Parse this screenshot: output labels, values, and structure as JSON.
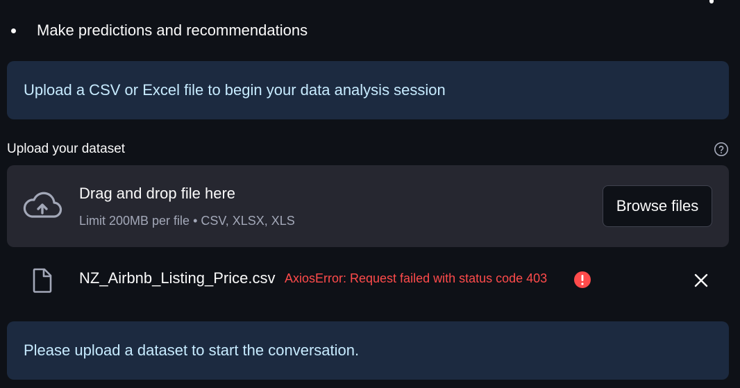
{
  "bullet": {
    "text": "Make predictions and recommendations"
  },
  "info_top": {
    "text": "Upload a CSV or Excel file to begin your data analysis session"
  },
  "uploader": {
    "label": "Upload your dataset",
    "help_icon": "question-circle-icon",
    "drop_title": "Drag and drop file here",
    "drop_subtitle": "Limit 200MB per file • CSV, XLSX, XLS",
    "browse_label": "Browse files",
    "cloud_icon": "cloud-upload-icon"
  },
  "file": {
    "name": "NZ_Airbnb_Listing_Price.csv",
    "error": "AxiosError: Request failed with status code 403",
    "file_icon": "file-icon",
    "error_icon": "error-exclamation-icon",
    "close_icon": "close-icon"
  },
  "info_bottom": {
    "text": "Please upload a dataset to start the conversation."
  },
  "colors": {
    "background": "#0e1117",
    "info_background": "#1c2a40",
    "info_text": "#c7ebff",
    "dropzone_background": "#262730",
    "error": "#ff4b4b"
  }
}
